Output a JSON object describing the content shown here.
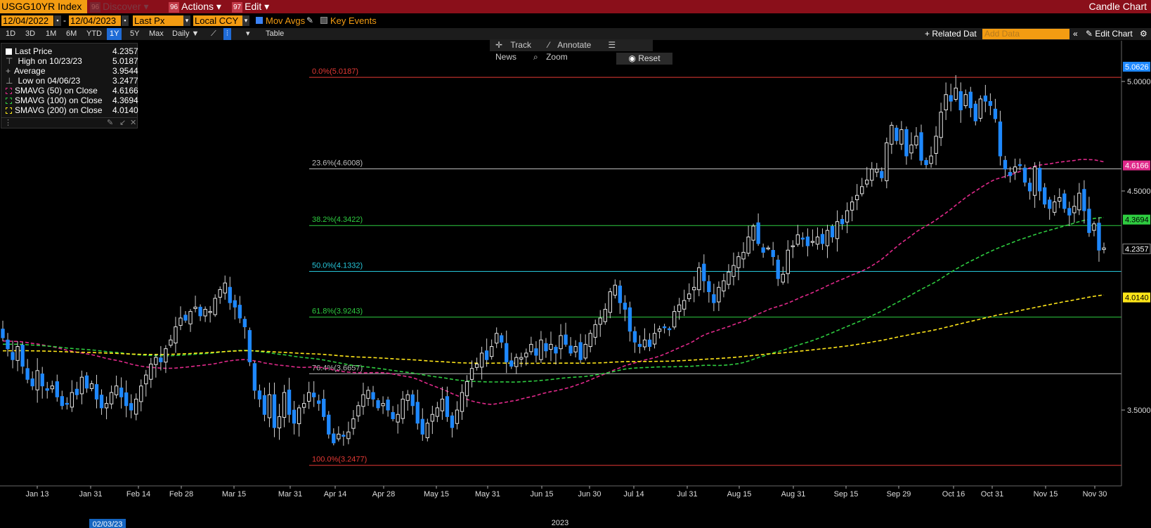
{
  "header": {
    "ticker": "USGG10YR Index",
    "discover_num": "96",
    "discover": "Discover",
    "actions_num": "96",
    "actions": "Actions",
    "edit_num": "97",
    "edit": "Edit",
    "title": "Candle Chart"
  },
  "controls": {
    "start_date": "12/04/2022",
    "end_date": "12/04/2023",
    "price_field": "Last Px",
    "currency": "Local CCY",
    "mov_avgs": "Mov Avgs",
    "key_events": "Key Events"
  },
  "periods": [
    "1D",
    "3D",
    "1M",
    "6M",
    "YTD",
    "1Y",
    "5Y",
    "Max"
  ],
  "active_period": "1Y",
  "frequency": "Daily",
  "table_label": "Table",
  "related_data": "Related Dat",
  "add_data_placeholder": "Add Data",
  "edit_chart": "Edit Chart",
  "tools": [
    "Track",
    "Annotate",
    "News",
    "Zoom"
  ],
  "reset": "Reset",
  "legend": {
    "last_price_label": "Last Price",
    "last_price": "4.2357",
    "high_label": "High on 10/23/23",
    "high": "5.0187",
    "average_label": "Average",
    "average": "3.9544",
    "low_label": "Low on 04/06/23",
    "low": "3.2477",
    "sma50_label": "SMAVG (50)  on Close",
    "sma50": "4.6166",
    "sma100_label": "SMAVG (100)  on Close",
    "sma100": "4.3694",
    "sma200_label": "SMAVG (200)  on Close",
    "sma200": "4.0140"
  },
  "colors": {
    "candle": "#1e88ff",
    "sma50": "#e0298a",
    "sma100": "#2ecc40",
    "sma200": "#ffe619",
    "fib_red": "#e53935",
    "fib_green": "#2ecc40",
    "fib_cyan": "#26c6da",
    "fib_grey": "#bdbdbd"
  },
  "chart_data": {
    "type": "candlestick",
    "x_ticks": [
      "Jan 13",
      "Jan 31",
      "Feb 14",
      "Feb 28",
      "Mar 15",
      "Mar 31",
      "Apr 14",
      "Apr 28",
      "May 15",
      "May 31",
      "Jun 15",
      "Jun 30",
      "Jul 14",
      "Jul 31",
      "Aug 15",
      "Aug 31",
      "Sep 15",
      "Sep 29",
      "Oct 16",
      "Oct 31",
      "Nov 15",
      "Nov 30"
    ],
    "x_year": "2023",
    "x_cursor_label": "02/03/23",
    "y_ticks": [
      5.0,
      4.5,
      3.5
    ],
    "y_tick_labels": [
      "5.0000",
      "4.5000",
      "3.5000"
    ],
    "ylim": [
      3.15,
      5.1
    ],
    "fib_levels": [
      {
        "label": "0.0%(5.0187)",
        "value": 5.0187
      },
      {
        "label": "23.6%(4.6008)",
        "value": 4.6008
      },
      {
        "label": "38.2%(4.3422)",
        "value": 4.3422
      },
      {
        "label": "50.0%(4.1332)",
        "value": 4.1332
      },
      {
        "label": "61.8%(3.9243)",
        "value": 3.9243
      },
      {
        "label": "76.4%(3.6657)",
        "value": 3.6657
      },
      {
        "label": "100.0%(3.2477)",
        "value": 3.2477
      }
    ],
    "price_tags": [
      {
        "label": "5.0626",
        "value": 5.0626,
        "type": "blue"
      },
      {
        "label": "4.6166",
        "value": 4.6166,
        "type": "sma50"
      },
      {
        "label": "4.3694",
        "value": 4.3694,
        "type": "sma100"
      },
      {
        "label": "4.2357",
        "value": 4.2357,
        "type": "last"
      },
      {
        "label": "4.0140",
        "value": 4.014,
        "type": "sma200"
      }
    ],
    "close": [
      3.83,
      3.78,
      3.73,
      3.79,
      3.7,
      3.64,
      3.61,
      3.68,
      3.61,
      3.59,
      3.61,
      3.56,
      3.52,
      3.53,
      3.58,
      3.57,
      3.65,
      3.6,
      3.62,
      3.55,
      3.51,
      3.53,
      3.58,
      3.61,
      3.56,
      3.52,
      3.5,
      3.55,
      3.61,
      3.66,
      3.71,
      3.74,
      3.72,
      3.78,
      3.82,
      3.88,
      3.92,
      3.91,
      3.95,
      3.97,
      3.93,
      3.96,
      3.95,
      4.01,
      4.05,
      4.08,
      3.99,
      3.97,
      3.92,
      3.88,
      3.72,
      3.59,
      3.55,
      3.48,
      3.57,
      3.42,
      3.47,
      3.58,
      3.48,
      3.44,
      3.51,
      3.53,
      3.58,
      3.56,
      3.53,
      3.47,
      3.39,
      3.35,
      3.39,
      3.38,
      3.4,
      3.46,
      3.52,
      3.57,
      3.59,
      3.55,
      3.51,
      3.53,
      3.5,
      3.46,
      3.48,
      3.55,
      3.57,
      3.52,
      3.44,
      3.39,
      3.44,
      3.48,
      3.51,
      3.55,
      3.47,
      3.42,
      3.5,
      3.58,
      3.63,
      3.69,
      3.71,
      3.76,
      3.73,
      3.79,
      3.85,
      3.81,
      3.72,
      3.7,
      3.74,
      3.74,
      3.76,
      3.8,
      3.75,
      3.82,
      3.77,
      3.8,
      3.76,
      3.84,
      3.8,
      3.76,
      3.79,
      3.73,
      3.8,
      3.85,
      3.89,
      3.92,
      3.96,
      4.04,
      4.07,
      3.99,
      3.96,
      3.86,
      3.81,
      3.79,
      3.82,
      3.79,
      3.85,
      3.87,
      3.88,
      3.87,
      3.95,
      3.98,
      4.0,
      4.03,
      4.06,
      4.15,
      4.09,
      4.04,
      3.99,
      4.06,
      4.09,
      4.13,
      4.16,
      4.2,
      4.22,
      4.29,
      4.34,
      4.26,
      4.22,
      4.24,
      4.2,
      4.1,
      4.12,
      4.23,
      4.25,
      4.3,
      4.28,
      4.25,
      4.27,
      4.29,
      4.26,
      4.32,
      4.29,
      4.36,
      4.35,
      4.41,
      4.45,
      4.48,
      4.52,
      4.55,
      4.6,
      4.6,
      4.56,
      4.72,
      4.8,
      4.73,
      4.78,
      4.66,
      4.71,
      4.75,
      4.64,
      4.62,
      4.66,
      4.75,
      4.86,
      4.94,
      4.91,
      4.97,
      4.87,
      4.94,
      4.88,
      4.82,
      4.92,
      4.91,
      4.89,
      4.83,
      4.66,
      4.6,
      4.57,
      4.61,
      4.62,
      4.54,
      4.5,
      4.61,
      4.5,
      4.44,
      4.42,
      4.45,
      4.47,
      4.42,
      4.39,
      4.43,
      4.49,
      4.41,
      4.31,
      4.35,
      4.23,
      4.24
    ]
  }
}
